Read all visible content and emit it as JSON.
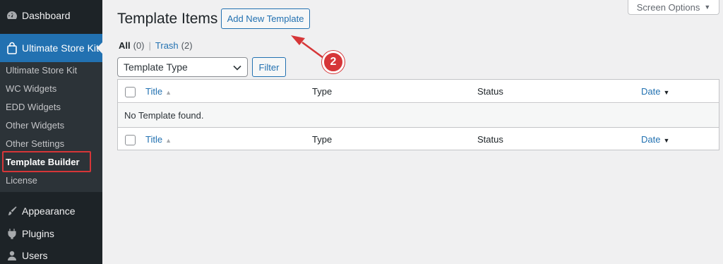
{
  "sidebar": {
    "top_items": [
      {
        "label": "Dashboard",
        "icon": "dashboard-icon"
      },
      {
        "label": "Ultimate Store Kit",
        "icon": "shopping-bag-icon"
      },
      {
        "label": "Appearance",
        "icon": "paintbrush-icon"
      },
      {
        "label": "Plugins",
        "icon": "plugin-icon"
      },
      {
        "label": "Users",
        "icon": "user-icon"
      }
    ],
    "submenu": [
      {
        "label": "Ultimate Store Kit"
      },
      {
        "label": "WC Widgets"
      },
      {
        "label": "EDD Widgets"
      },
      {
        "label": "Other Widgets"
      },
      {
        "label": "Other Settings"
      },
      {
        "label": "Template Builder"
      },
      {
        "label": "License"
      }
    ],
    "accent_color": "#2271b1",
    "highlight_color": "#d63638"
  },
  "header": {
    "title": "Template Items",
    "add_new_label": "Add New Template",
    "screen_options_label": "Screen Options"
  },
  "views": {
    "all_label": "All",
    "all_count": "(0)",
    "separator": "|",
    "trash_label": "Trash",
    "trash_count": "(2)"
  },
  "filters": {
    "type_select_value": "Template Type",
    "filter_label": "Filter"
  },
  "table": {
    "columns": [
      "Title",
      "Type",
      "Status",
      "Date"
    ],
    "empty_message": "No Template found."
  },
  "annotation": {
    "step_number": "2"
  }
}
